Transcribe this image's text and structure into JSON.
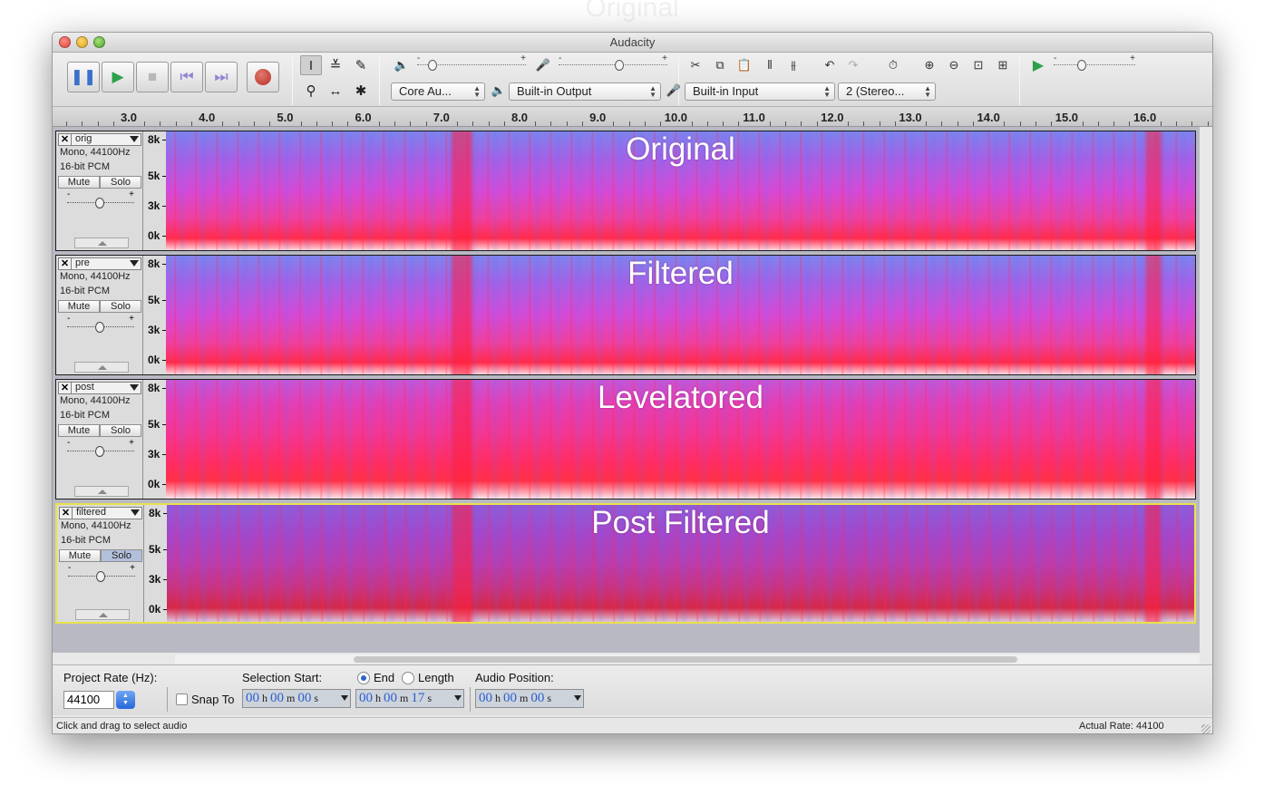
{
  "background_heading": "Original",
  "window": {
    "title": "Audacity"
  },
  "toolbar": {
    "transport": [
      "pause",
      "play",
      "stop",
      "skip-start",
      "skip-end",
      "record"
    ],
    "output_device_host": "Core Au...",
    "output_device": "Built-in Output",
    "input_device": "Built-in Input",
    "input_channels": "2 (Stereo..."
  },
  "ruler": {
    "ticks": [
      "3.0",
      "4.0",
      "5.0",
      "6.0",
      "7.0",
      "8.0",
      "9.0",
      "10.0",
      "11.0",
      "12.0",
      "13.0",
      "14.0",
      "15.0",
      "16.0"
    ]
  },
  "tracks": [
    {
      "name": "orig",
      "info1": "Mono, 44100Hz",
      "info2": "16-bit PCM",
      "mute": "Mute",
      "solo": "Solo",
      "label": "Original",
      "scale": [
        "8k",
        "5k",
        "3k",
        "0k"
      ]
    },
    {
      "name": "pre",
      "info1": "Mono, 44100Hz",
      "info2": "16-bit PCM",
      "mute": "Mute",
      "solo": "Solo",
      "label": "Filtered",
      "scale": [
        "8k",
        "5k",
        "3k",
        "0k"
      ]
    },
    {
      "name": "post",
      "info1": "Mono, 44100Hz",
      "info2": "16-bit PCM",
      "mute": "Mute",
      "solo": "Solo",
      "label": "Levelatored",
      "scale": [
        "8k",
        "5k",
        "3k",
        "0k"
      ]
    },
    {
      "name": "filtered",
      "info1": "Mono, 44100Hz",
      "info2": "16-bit PCM",
      "mute": "Mute",
      "solo": "Solo",
      "label": "Post Filtered",
      "scale": [
        "8k",
        "5k",
        "3k",
        "0k"
      ]
    }
  ],
  "selection_bar": {
    "project_rate_label": "Project Rate (Hz):",
    "project_rate": "44100",
    "snap_to": "Snap To",
    "selection_start_label": "Selection Start:",
    "end_label": "End",
    "length_label": "Length",
    "audio_position_label": "Audio Position:",
    "h": "h",
    "m": "m",
    "s": "s",
    "start": {
      "h": "00",
      "m": "00",
      "s": "00"
    },
    "end": {
      "h": "00",
      "m": "00",
      "s": "17"
    },
    "position": {
      "h": "00",
      "m": "00",
      "s": "00"
    }
  },
  "status": {
    "message": "Click and drag to select audio",
    "rate": "Actual Rate: 44100"
  }
}
